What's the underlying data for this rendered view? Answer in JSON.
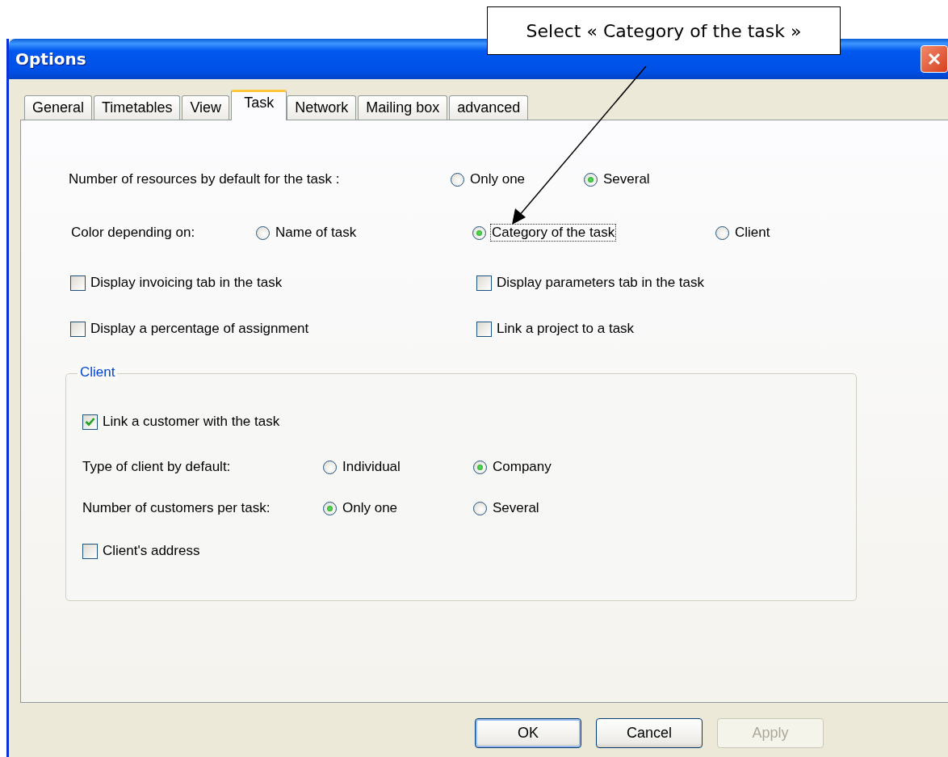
{
  "window": {
    "title": "Options"
  },
  "tabs": [
    {
      "label": "General",
      "selected": false
    },
    {
      "label": "Timetables",
      "selected": false
    },
    {
      "label": "View",
      "selected": false
    },
    {
      "label": "Task",
      "selected": true
    },
    {
      "label": "Network",
      "selected": false
    },
    {
      "label": "Mailing box",
      "selected": false
    },
    {
      "label": "advanced",
      "selected": false
    }
  ],
  "resources": {
    "label": "Number of resources by default for the task :",
    "options": [
      {
        "label": "Only one",
        "selected": false
      },
      {
        "label": "Several",
        "selected": true
      }
    ]
  },
  "color_by": {
    "label": "Color depending on:",
    "options": [
      {
        "label": "Name of task",
        "selected": false,
        "focused": false
      },
      {
        "label": "Category of the task",
        "selected": true,
        "focused": true
      },
      {
        "label": "Client",
        "selected": false,
        "focused": false
      }
    ]
  },
  "checkboxes": [
    {
      "label": "Display invoicing tab in the task",
      "checked": false
    },
    {
      "label": "Display parameters tab in the task",
      "checked": false
    },
    {
      "label": "Display a percentage of assignment",
      "checked": false
    },
    {
      "label": "Link a project to a task",
      "checked": false
    }
  ],
  "client_group": {
    "title": "Client",
    "link_customer": {
      "label": "Link a customer with the task",
      "checked": true
    },
    "client_type": {
      "label": "Type of client by default:",
      "options": [
        {
          "label": "Individual",
          "selected": false
        },
        {
          "label": "Company",
          "selected": true
        }
      ]
    },
    "customers_per_task": {
      "label": "Number of customers per task:",
      "options": [
        {
          "label": "Only one",
          "selected": true
        },
        {
          "label": "Several",
          "selected": false
        }
      ]
    },
    "address": {
      "label": "Client's address",
      "checked": false
    }
  },
  "buttons": [
    {
      "label": "OK",
      "default": true,
      "disabled": false
    },
    {
      "label": "Cancel",
      "default": false,
      "disabled": false
    },
    {
      "label": "Apply",
      "default": false,
      "disabled": true
    }
  ],
  "callout": {
    "text": "Select « Category of the task »"
  }
}
